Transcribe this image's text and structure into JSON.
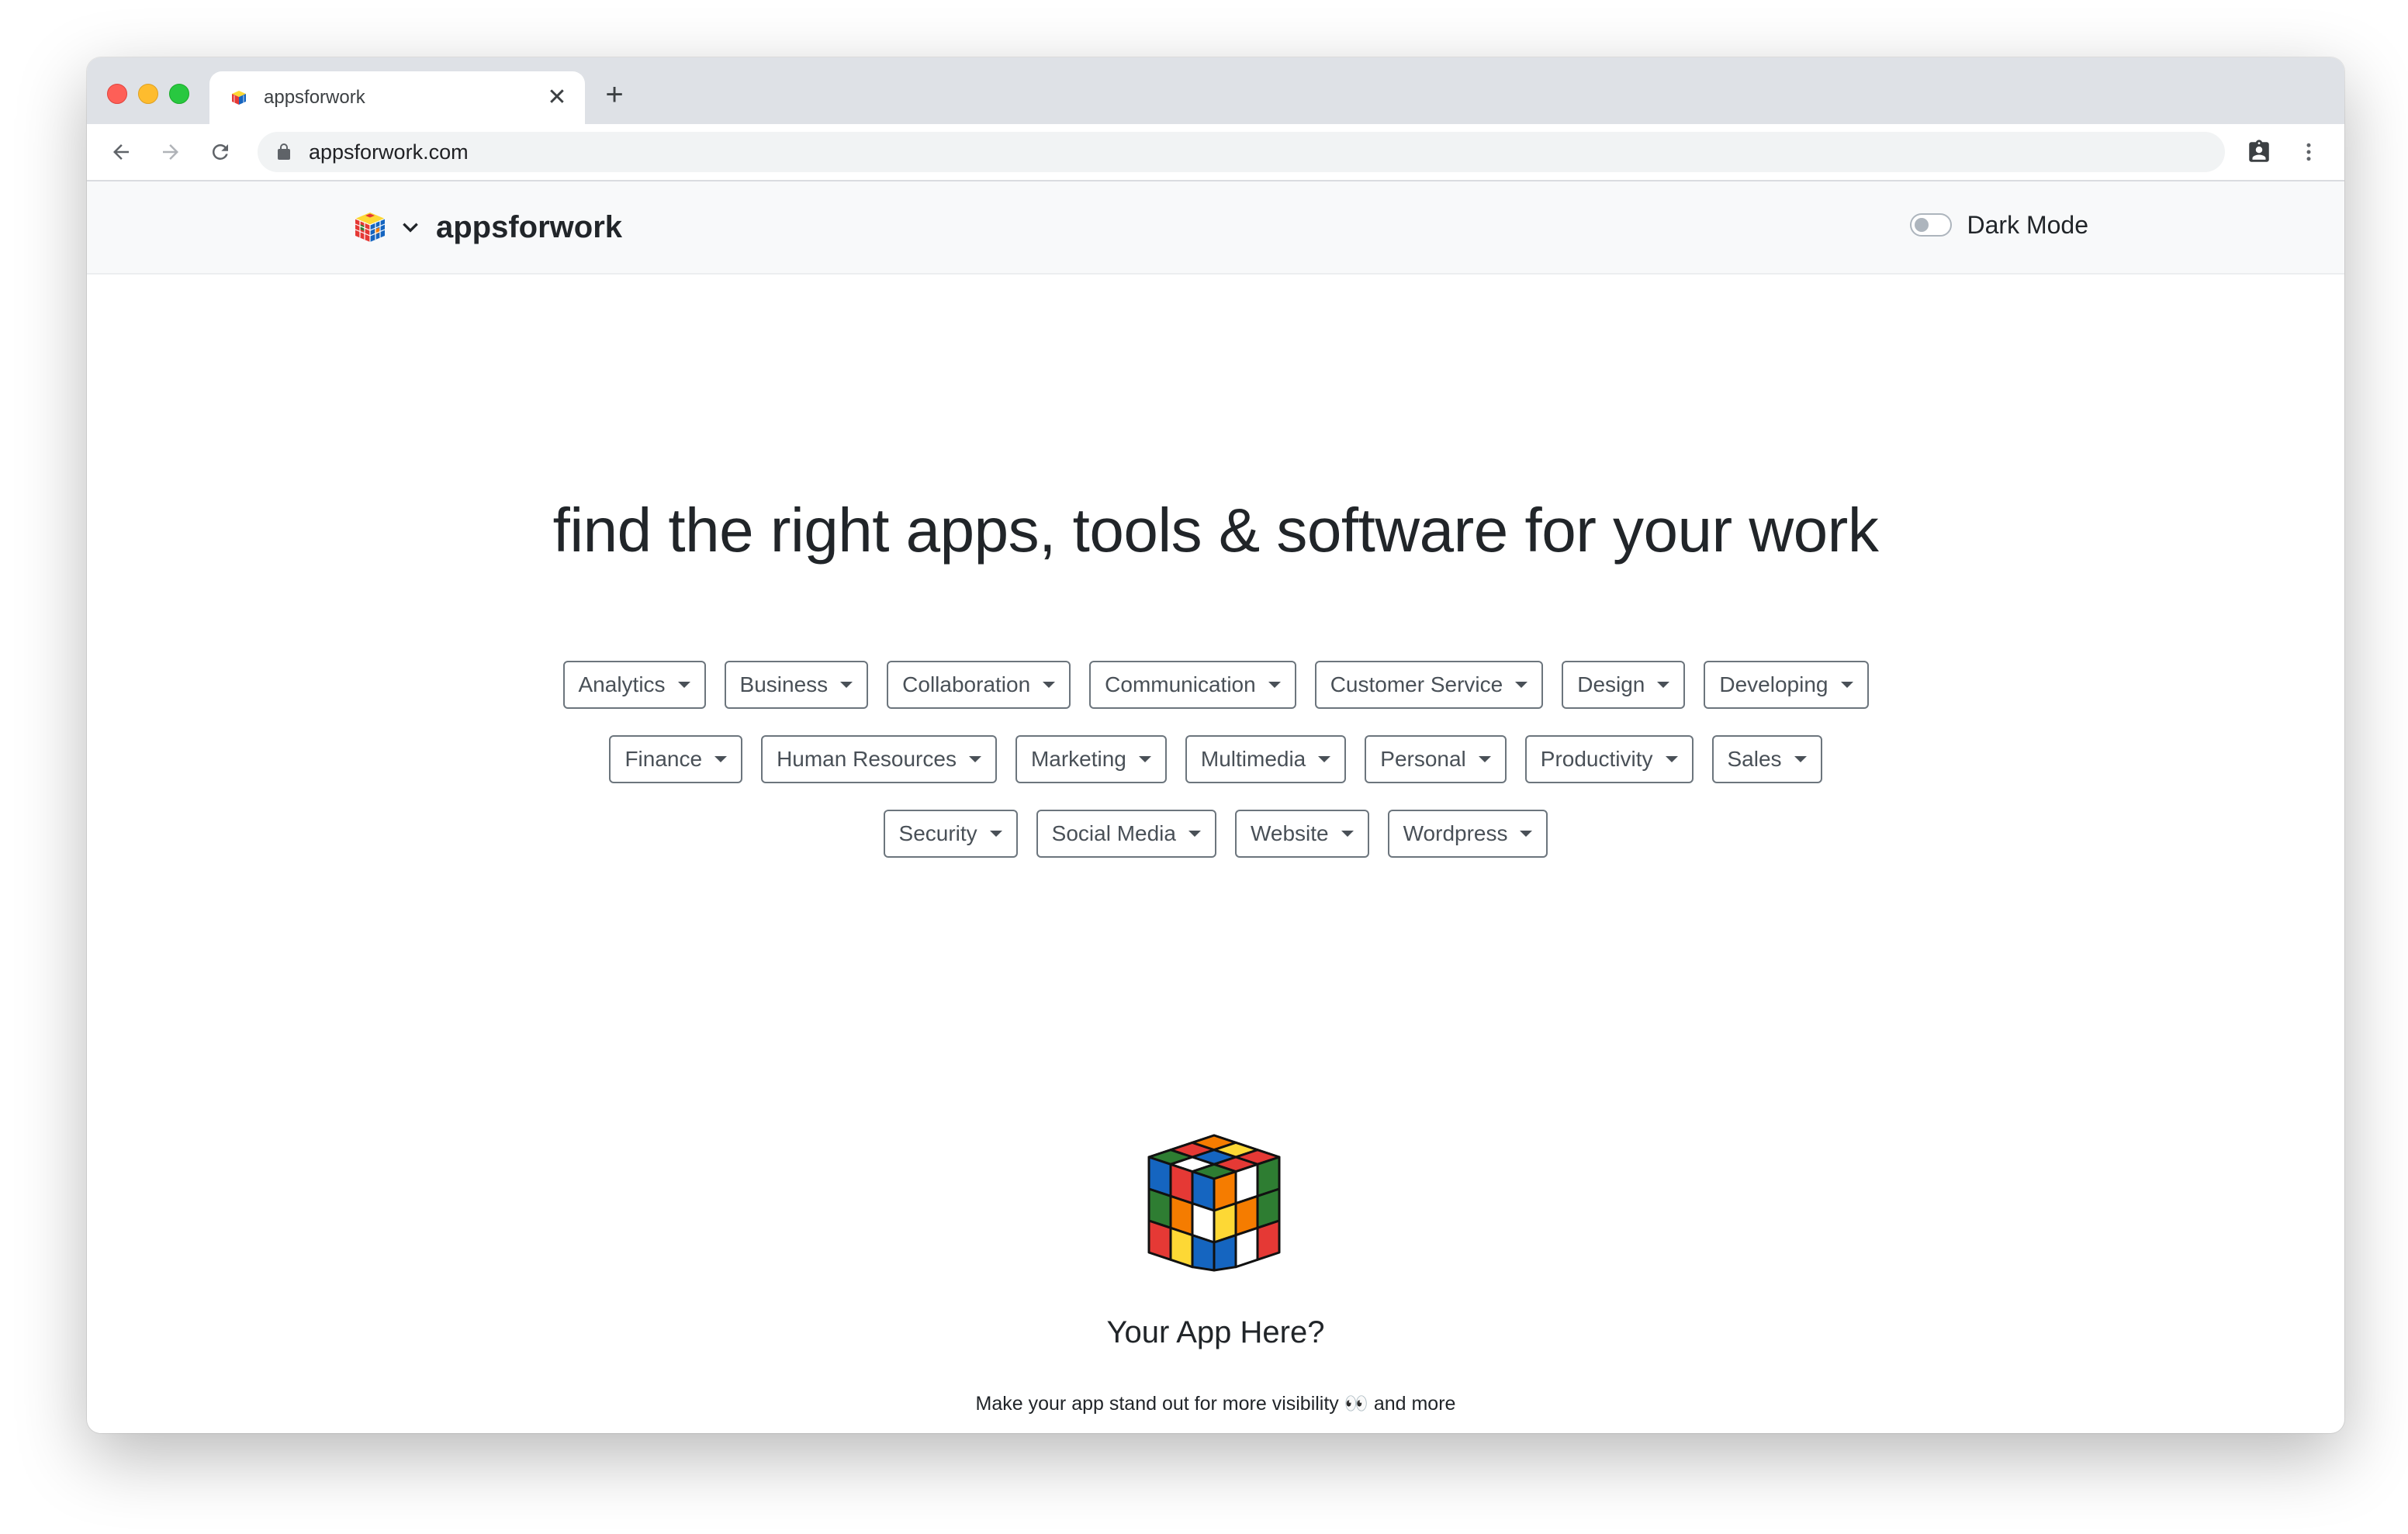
{
  "browser": {
    "tab_title": "appsforwork",
    "tab_close_glyph": "✕",
    "new_tab_glyph": "+",
    "url": "appsforwork.com",
    "icons": [
      "back-icon",
      "forward-icon",
      "reload-icon",
      "lock-icon",
      "profile-icon",
      "menu-icon"
    ]
  },
  "site": {
    "brand": "appsforwork",
    "dark_mode_label": "Dark Mode",
    "dark_mode_on": false
  },
  "hero": {
    "title": "find the right apps, tools & software for your work"
  },
  "categories": [
    "Analytics",
    "Business",
    "Collaboration",
    "Communication",
    "Customer Service",
    "Design",
    "Developing",
    "Finance",
    "Human Resources",
    "Marketing",
    "Multimedia",
    "Personal",
    "Productivity",
    "Sales",
    "Security",
    "Social Media",
    "Website",
    "Wordpress"
  ],
  "promo": {
    "title": "Your App Here?",
    "subtitle": "Make your app stand out for more visibility 👀  and more"
  },
  "colors": {
    "tabstrip": "#dee1e6",
    "nav_bg": "#f8f9fa",
    "button_border": "#6c757d",
    "cube_red": "#e53935",
    "cube_blue": "#1565c0",
    "cube_green": "#2e7d32",
    "cube_orange": "#f57c00",
    "cube_yellow": "#fdd835"
  }
}
